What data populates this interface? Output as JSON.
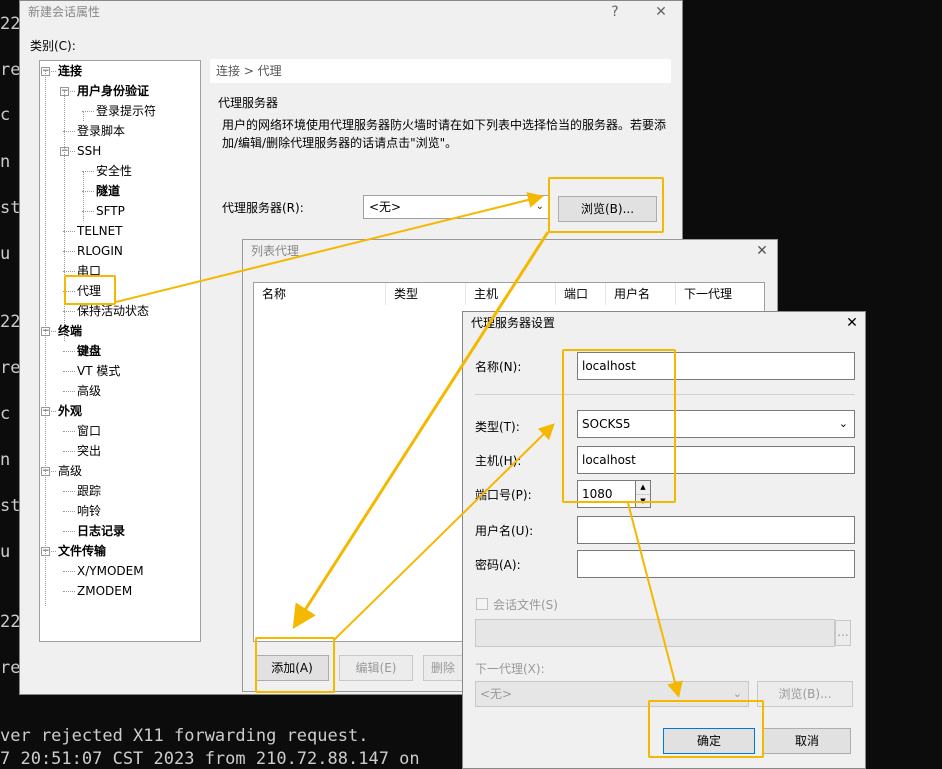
{
  "terminal": {
    "left_fragments": [
      "22",
      "re",
      " c",
      "n",
      "st",
      " u",
      "22",
      "re",
      " c",
      "n",
      "st",
      " u",
      "22",
      "re"
    ],
    "bottom_line1": "ver rejected X11 forwarding request.",
    "bottom_line2": " 7 20:51:07 CST 2023 from 210.72.88.147 on"
  },
  "main_window": {
    "title": "新建会话属性",
    "help": "?",
    "close": "✕",
    "category_label": "类别(C):",
    "breadcrumb": "连接 > 代理",
    "group_title": "代理服务器",
    "group_desc": "用户的网络环境使用代理服务器防火墙时请在如下列表中选择恰当的服务器。若要添加/编辑/删除代理服务器的话请点击\"浏览\"。",
    "proxy_label": "代理服务器(R):",
    "proxy_value": "<无>",
    "browse_button": "浏览(B)...",
    "tree": [
      {
        "label": "连接",
        "bold": true
      },
      {
        "label": "用户身份验证",
        "bold": true
      },
      {
        "label": "登录提示符",
        "bold": false
      },
      {
        "label": "登录脚本",
        "bold": false
      },
      {
        "label": "SSH",
        "bold": false
      },
      {
        "label": "安全性",
        "bold": false
      },
      {
        "label": "隧道",
        "bold": true
      },
      {
        "label": "SFTP",
        "bold": false
      },
      {
        "label": "TELNET",
        "bold": false
      },
      {
        "label": "RLOGIN",
        "bold": false
      },
      {
        "label": "串口",
        "bold": false
      },
      {
        "label": "代理",
        "bold": false
      },
      {
        "label": "保持活动状态",
        "bold": false
      },
      {
        "label": "终端",
        "bold": true
      },
      {
        "label": "键盘",
        "bold": true
      },
      {
        "label": "VT 模式",
        "bold": false
      },
      {
        "label": "高级",
        "bold": false
      },
      {
        "label": "外观",
        "bold": true
      },
      {
        "label": "窗口",
        "bold": false
      },
      {
        "label": "突出",
        "bold": false
      },
      {
        "label": "高级",
        "bold": false
      },
      {
        "label": "跟踪",
        "bold": false
      },
      {
        "label": "响铃",
        "bold": false
      },
      {
        "label": "日志记录",
        "bold": true
      },
      {
        "label": "文件传输",
        "bold": true
      },
      {
        "label": "X/YMODEM",
        "bold": false
      },
      {
        "label": "ZMODEM",
        "bold": false
      }
    ]
  },
  "list_window": {
    "title": "列表代理",
    "close": "✕",
    "columns": [
      "名称",
      "类型",
      "主机",
      "端口",
      "用户名",
      "下一代理"
    ],
    "add_button": "添加(A)",
    "edit_button": "编辑(E)",
    "delete_button": "删除"
  },
  "settings_window": {
    "title": "代理服务器设置",
    "close": "✕",
    "name_label": "名称(N):",
    "name_value": "localhost",
    "type_label": "类型(T):",
    "type_value": "SOCKS5",
    "host_label": "主机(H):",
    "host_value": "localhost",
    "port_label": "端口号(P):",
    "port_value": "1080",
    "user_label": "用户名(U):",
    "user_value": "",
    "password_label": "密码(A):",
    "password_value": "",
    "session_file_label": "会话文件(S)",
    "session_file_browse": "...",
    "next_proxy_label": "下一代理(X):",
    "next_proxy_value": "<无>",
    "next_proxy_browse": "浏览(B)...",
    "ok_button": "确定",
    "cancel_button": "取消"
  },
  "colors": {
    "highlight": "#f5b800",
    "terminal_bg": "#0c0c0c"
  }
}
